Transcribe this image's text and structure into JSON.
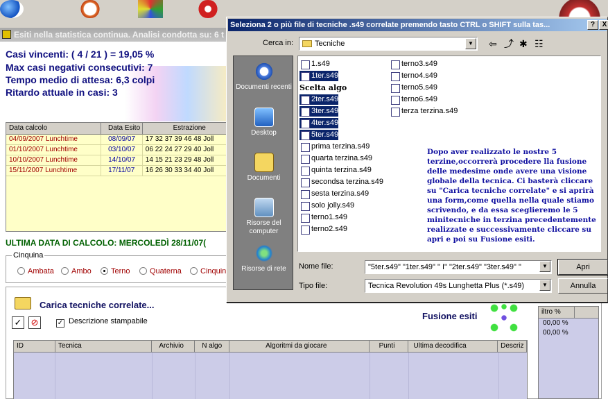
{
  "main": {
    "title": "Esiti nella statistica continua. Analisi condotta su: 6 t",
    "stats": [
      "Casi vincenti: ( 4 / 21 ) = 19,05 %",
      "Max casi negativi consecutivi: 7",
      "Tempo medio di attesa: 6,3 colpi",
      "Ritardo attuale in casi: 3"
    ],
    "grid": {
      "headers": [
        "Data calcolo",
        "Data Esito",
        "Estrazione"
      ],
      "rows": [
        [
          "04/09/2007 Lunchtime",
          "08/09/07",
          "17 32 37 39 46 48 Joll"
        ],
        [
          "01/10/2007 Lunchtime",
          "03/10/07",
          "06 22 24 27 29 40 Joll"
        ],
        [
          "10/10/2007 Lunchtime",
          "14/10/07",
          "14 15 21 23 29 48 Joll"
        ],
        [
          "15/11/2007 Lunchtime",
          "17/11/07",
          "16 26 30 33 34 40 Joll"
        ]
      ]
    },
    "ultima": "ULTIMA DATA DI CALCOLO: MERCOLEDÌ 28/11/07(",
    "cinquina": {
      "legend": "Cinquina",
      "options": [
        "Ambata",
        "Ambo",
        "Terno",
        "Quaterna",
        "Cinquin"
      ],
      "selected": "Terno"
    },
    "carica_title": "Carica tecniche correlate...",
    "descrizione": "Descrizione stampabile",
    "fusione": "Fusione esiti",
    "grid2_headers": [
      "ID",
      "Tecnica",
      "Archivio",
      "N algo",
      "Algoritmi da giocare",
      "Punti",
      "Ultima decodifica",
      "Descriz"
    ],
    "grid3": {
      "header": "iltro %",
      "rows": [
        "00,00 %",
        "00,00 %"
      ]
    }
  },
  "dialog": {
    "title": "Seleziona 2 o più file di tecniche .s49 correlate premendo tasto CTRL o SHIFT sulla tas...",
    "help_btn": "?",
    "close_btn": "X",
    "cerca_label": "Cerca in:",
    "cerca_value": "Tecniche",
    "places": [
      "Documenti recenti",
      "Desktop",
      "Documenti",
      "Risorse del computer",
      "Risorse di rete"
    ],
    "files_col1": [
      "1.s49",
      "1ter.s49",
      "2ter.s49",
      "3ter.s49",
      "4ter.s49",
      "5ter.s49",
      "prima terzina.s49",
      "quarta terzina.s49",
      "quinta terzina.s49",
      "secondsa terzina.s49",
      "sesta terzina.s49",
      "solo jolly.s49",
      "terno1.s49",
      "terno2.s49"
    ],
    "files_col2": [
      "terno3.s49",
      "terno4.s49",
      "terno5.s49",
      "terno6.s49",
      "terza terzina.s49"
    ],
    "scelta": "Scelta algo",
    "note": "Dopo aver realizzato le nostre 5 terzine,occorrerà procedere lla fusione delle medesime onde avere una visione globale della tecnica. Ci basterà cliccare su \"Carica tecniche correlate\" e si aprirà una form,come quella nella quale stiamo scrivendo, e da essa sceglieremo le 5 minitecniche in terzina precedentemente realizzate e successivamente cliccare su apri  e poi su Fusione esiti.",
    "nome_label": "Nome file:",
    "nome_value": "\"5ter.s49\" \"1ter.s49\" \"     I\" \"2ter.s49\" \"3ter.s49\" \"",
    "tipo_label": "Tipo file:",
    "tipo_value": "Tecnica Revolution 49s Lunghetta Plus (*.s49)",
    "apri": "Apri",
    "annulla": "Annulla"
  },
  "colors": {
    "title_active": "#0a246a",
    "selection": "#0a246a",
    "stat_text": "#101080",
    "note_text": "#1010a0",
    "grid_bg": "#ffffc8",
    "red_row": "#a00000"
  }
}
